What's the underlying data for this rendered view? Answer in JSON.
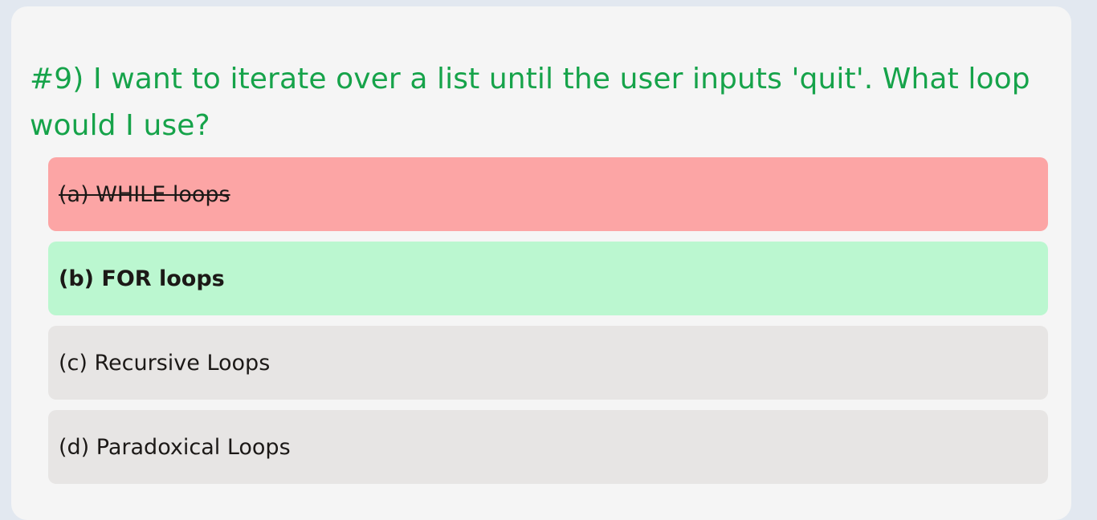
{
  "question": {
    "text": "#9) I want to iterate over a list until the user inputs 'quit'. What loop would I use?"
  },
  "options": [
    {
      "label": "(a) WHILE loops",
      "state": "incorrect-selected"
    },
    {
      "label": "(b) FOR loops",
      "state": "correct"
    },
    {
      "label": "(c) Recursive Loops",
      "state": "neutral"
    },
    {
      "label": "(d) Paradoxical Loops",
      "state": "neutral"
    }
  ],
  "colors": {
    "question_text": "#16a34a",
    "incorrect_bg": "#fca5a5",
    "correct_bg": "#bbf7d0",
    "neutral_bg": "#e7e5e4",
    "card_bg": "#f5f5f5",
    "page_bg": "#e2e8f0"
  }
}
